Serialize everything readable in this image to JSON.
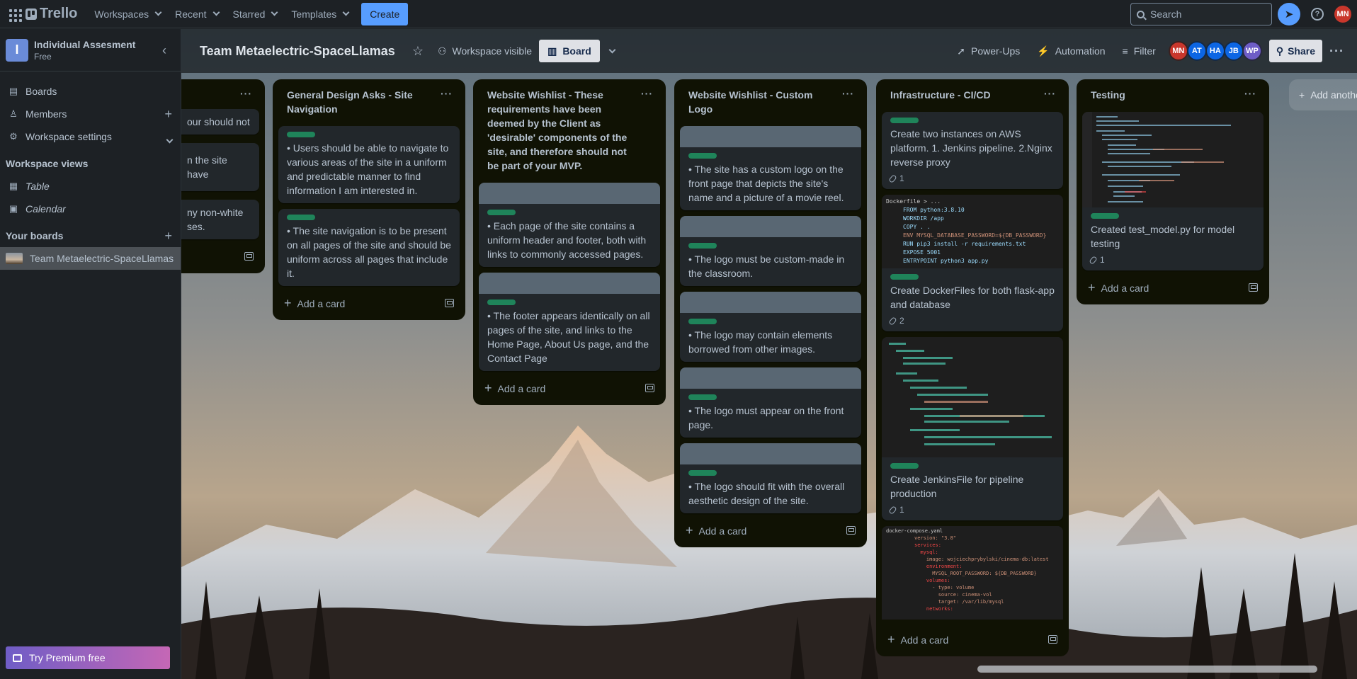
{
  "topbar": {
    "app_name": "Trello",
    "menus": [
      "Workspaces",
      "Recent",
      "Starred",
      "Templates"
    ],
    "create_label": "Create",
    "search_placeholder": "Search",
    "user_initials": "MN"
  },
  "board": {
    "title": "Team Metaelectric-SpaceLlamas",
    "visibility": "Workspace visible",
    "view": "Board",
    "power_ups": "Power-Ups",
    "automation": "Automation",
    "filter": "Filter",
    "share": "Share",
    "members": [
      {
        "initials": "MN",
        "color": "#c9372c"
      },
      {
        "initials": "AT",
        "color": "#0c66e4"
      },
      {
        "initials": "HA",
        "color": "#0c66e4"
      },
      {
        "initials": "JB",
        "color": "#0c66e4"
      },
      {
        "initials": "WP",
        "color": "#6e5dc6"
      }
    ]
  },
  "sidebar": {
    "workspace_name": "Individual Assesment",
    "workspace_plan": "Free",
    "workspace_initial": "I",
    "nav": [
      "Boards",
      "Members",
      "Workspace settings"
    ],
    "views_heading": "Workspace views",
    "views": [
      "Table",
      "Calendar"
    ],
    "your_boards_heading": "Your boards",
    "boards": [
      "Team Metaelectric-SpaceLlamas"
    ],
    "premium_label": "Try Premium free"
  },
  "lists": [
    {
      "title": "",
      "cards": [
        {
          "title": "our should not"
        },
        {
          "title": "n the site have"
        },
        {
          "title": "ny non-white\nses."
        }
      ]
    },
    {
      "title": "General Design Asks - Site Navigation",
      "cards": [
        {
          "title": "• Users should be able to navigate to various areas of the site in a uniform and predictable manner to find information I am interested in."
        },
        {
          "title": "• The site navigation is to be present on all pages of the site and should be uniform across all pages that include it."
        }
      ]
    },
    {
      "title": "Website Wishlist - These requirements have been deemed by the Client as 'desirable' components of the site, and therefore should not be part of your MVP.",
      "cards": [
        {
          "title": "• Each page of the site contains a uniform header and footer, both with links to commonly accessed pages."
        },
        {
          "title": "• The footer appears identically on all pages of the site, and links to the Home Page, About Us page, and the Contact Page"
        }
      ]
    },
    {
      "title": "Website Wishlist - Custom Logo",
      "cards": [
        {
          "title": "• The site has a custom logo on the front page that depicts the site's name and a picture of a movie reel."
        },
        {
          "title": "• The logo must be custom-made in the classroom."
        },
        {
          "title": "• The logo may contain elements borrowed from other images."
        },
        {
          "title": "• The logo must appear on the front page."
        },
        {
          "title": "• The logo should fit with the overall aesthetic design of the site."
        }
      ]
    },
    {
      "title": "Infrastructure - CI/CD",
      "cards": [
        {
          "title": "Create two instances on AWS platform. 1. Jenkins pipeline. 2.Nginx reverse proxy",
          "attachments": "1"
        },
        {
          "title": "Create DockerFiles for both flask-app and database",
          "attachments": "2",
          "code_header": "Dockerfile > ...",
          "code": [
            "FROM python:3.8.10",
            "WORKDIR /app",
            "COPY . .",
            "ENV MYSQL_DATABASE_PASSWORD=${DB_PASSWORD}",
            "RUN pip3 install -r requirements.txt",
            "EXPOSE 5001",
            "ENTRYPOINT python3 app.py"
          ]
        },
        {
          "title": "Create JenkinsFile for pipeline production",
          "attachments": "1"
        },
        {
          "title": "",
          "code_header": "docker-compose.yaml",
          "code": [
            "version: \"3.8\"",
            "services:",
            "  mysql:",
            "    image: wojciechprybylski/cinema-db:latest",
            "    environment:",
            "      MYSQL_ROOT_PASSWORD: ${DB_PASSWORD}",
            "    volumes:",
            "      - type: volume",
            "        source: cinema-vol",
            "        target: /var/lib/mysql",
            "    networks:"
          ]
        }
      ]
    },
    {
      "title": "Testing",
      "cards": [
        {
          "title": "Created test_model.py for model testing",
          "attachments": "1"
        }
      ]
    }
  ],
  "add_card_label": "Add a card",
  "add_list_label": "Add another list"
}
